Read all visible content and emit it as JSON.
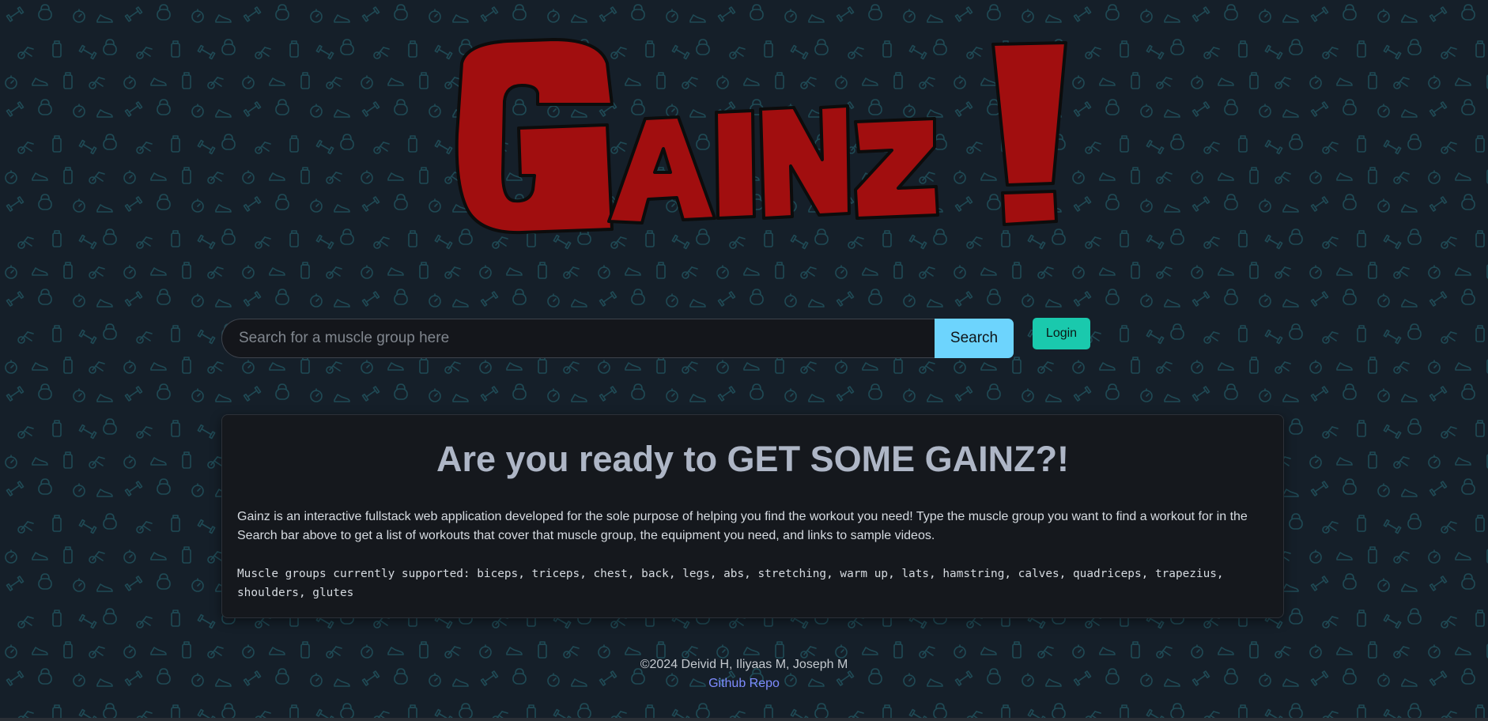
{
  "logo": {
    "text": "Gainz!",
    "fill_color": "#a10e0f",
    "outline_color": "#0c0c0c"
  },
  "search": {
    "placeholder": "Search for a muscle group here",
    "value": "",
    "button_label": "Search",
    "button_color": "#6dd4fd"
  },
  "auth": {
    "login_label": "Login",
    "login_color": "#1ac9ad"
  },
  "card": {
    "title": "Are you ready to GET SOME GAINZ?!",
    "description": "Gainz is an interactive fullstack web application developed for the sole purpose of helping you find the workout you need! Type the muscle group you want to find a workout for in the Search bar above to get a list of workouts that cover that muscle group, the equipment you need, and links to sample videos.",
    "muscles": "Muscle groups currently supported: biceps, triceps, chest, back, legs, abs, stretching, warm up, lats, hamstring, calves, quadriceps, trapezius, shoulders, glutes"
  },
  "footer": {
    "credit": "©2024 Deivid H, Iliyaas M, Joseph M",
    "link_label": "Github Repo",
    "link_color": "#7e8cff"
  },
  "theme": {
    "background": "#151f29",
    "pattern_icons": [
      "dumbbell-icon",
      "kettlebell-icon",
      "stopwatch-icon",
      "sneaker-icon",
      "exercise-bike-icon",
      "water-bottle-icon"
    ],
    "pattern_color": "#1f4a55",
    "card_background": "#15181d",
    "title_color": "#aeb6c6"
  }
}
